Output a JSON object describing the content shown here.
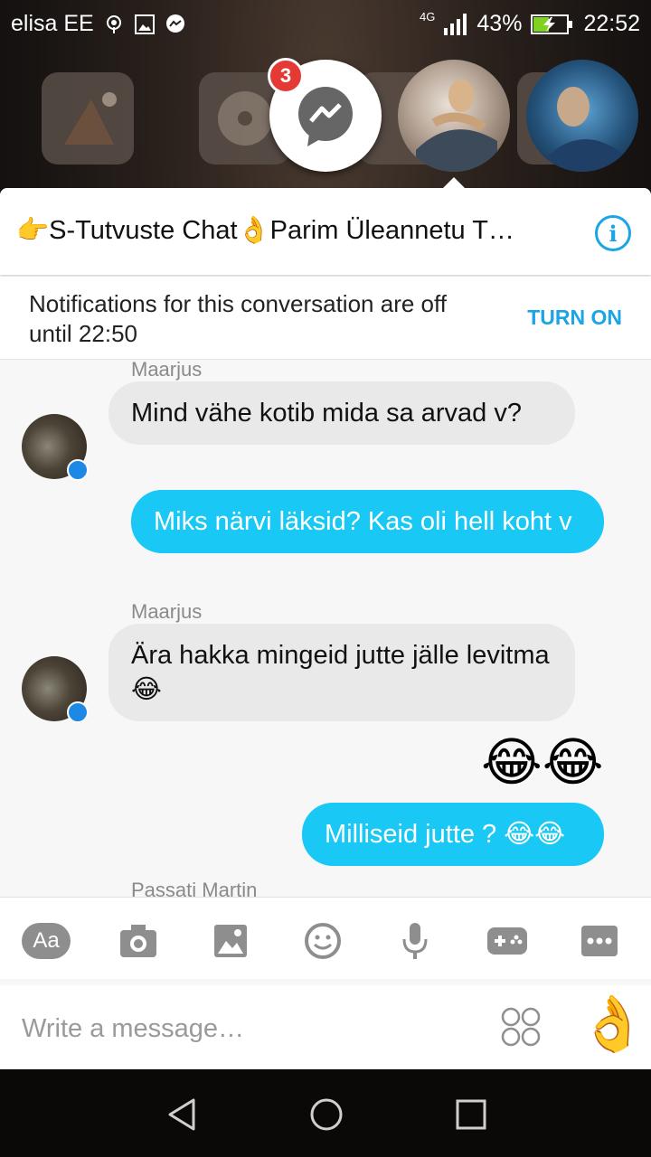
{
  "status_bar": {
    "carrier": "elisa EE",
    "network": "4G",
    "battery": "43%",
    "time": "22:52"
  },
  "chat_heads": {
    "messenger_badge": "3"
  },
  "chat": {
    "title": "👉S-Tutvuste Chat👌Parim Üleannetu T…",
    "info_icon": "i",
    "notification": {
      "text": "Notifications for this conversation are off until 22:50",
      "action": "TURN ON"
    },
    "messages": [
      {
        "sender": "Maarjus",
        "text": "Mind vähe kotib mida sa arvad v?"
      },
      {
        "text": "Miks närvi läksid? Kas oli hell koht v"
      },
      {
        "sender": "Maarjus",
        "text": "Ära hakka mingeid jutte jälle levitma 😂"
      },
      {
        "emoji": "😂😂"
      },
      {
        "text": "Milliseid jutte ? 😂😂"
      },
      {
        "sender": "Passati Martin"
      }
    ]
  },
  "composer": {
    "text_format_label": "Aa",
    "placeholder": "Write a message…",
    "like_emoji": "👌"
  },
  "colors": {
    "accent": "#1aa5e6",
    "outgoing_bubble": "#19c8f4",
    "incoming_bubble": "#e9e9e9",
    "badge": "#e53935"
  }
}
